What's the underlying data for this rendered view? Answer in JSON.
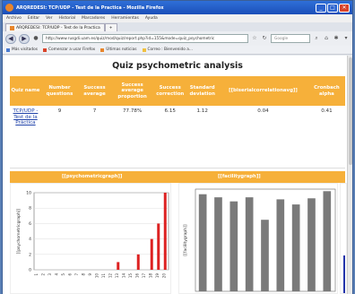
{
  "window": {
    "title": "ARQREDESI: TCP/UDP - Test de la Practica - Mozilla Firefox",
    "min_label": "_",
    "max_label": "□",
    "close_label": "✕"
  },
  "menu": [
    "Archivo",
    "Editar",
    "Ver",
    "Historial",
    "Marcadores",
    "Herramientas",
    "Ayuda"
  ],
  "tab": {
    "label": "ARQREDESI: TCP/UDP - Test de la Practica",
    "add_label": "+"
  },
  "nav": {
    "back": "◀",
    "forward": "▶",
    "url": "http://www.rusgdi.uam.es/quiz/mod/quiz/report.php?id=155&mode=quiz_psychometric",
    "search_placeholder": "Google"
  },
  "bookmarks": [
    {
      "label": "Más visitados",
      "color": "#4a7bd0"
    },
    {
      "label": "Comenzar a usar Firefox",
      "color": "#d9432a"
    },
    {
      "label": "Últimas noticias",
      "color": "#e8852b"
    },
    {
      "label": "Correo : Bienvenido a...",
      "color": "#f0c040"
    }
  ],
  "page": {
    "heading": "Quiz psychometric analysis",
    "table": {
      "headers": [
        "Quiz name",
        "Number questions",
        "Success average",
        "Success average proportion",
        "Success correction",
        "Standard deviation",
        "[[biserialcorrelationavg]]",
        "Cronbach alpha"
      ],
      "row": {
        "name": "TCP/UDP - Test de la Práctica",
        "questions": "9",
        "success_avg": "7",
        "success_prop": "77.78%",
        "correction": "6.15",
        "std_dev": "1.12",
        "biserial": "0.04",
        "cronbach": "0.41"
      }
    },
    "charts": {
      "left_title": "[[psychometricgraph]]",
      "right_title": "[[facilitygraph]]",
      "left_ylabel": "[[psychometricgraph]]",
      "right_ylabel": "[[facilitygraph]]"
    }
  },
  "chart_data": [
    {
      "type": "bar",
      "title": "[[psychometricgraph]]",
      "ylabel": "[[psychometricgraph]]",
      "yticks": [
        "0",
        "2",
        "4",
        "6",
        "8",
        "10"
      ],
      "ylim": [
        0,
        10
      ],
      "categories": [
        "1",
        "2",
        "3",
        "4",
        "5",
        "6",
        "7",
        "8",
        "9",
        "10",
        "11",
        "12",
        "13",
        "14",
        "15",
        "16",
        "17",
        "18",
        "19",
        "20"
      ],
      "values": [
        0,
        0,
        0,
        0,
        0,
        0,
        0,
        0,
        0,
        0,
        0,
        0,
        1,
        0,
        0,
        2,
        0,
        4,
        6,
        10
      ],
      "color": "#dd2222",
      "grid": true
    },
    {
      "type": "bar",
      "title": "[[facilitygraph]]",
      "ylabel": "[[facilitygraph]]",
      "ylim": [
        0,
        100
      ],
      "categories": [
        "1",
        "2",
        "3",
        "4",
        "5",
        "6",
        "7",
        "8",
        "9"
      ],
      "values": [
        95,
        92,
        88,
        92,
        70,
        90,
        85,
        91,
        98
      ],
      "color": "#7a7a7a",
      "grid": false
    }
  ]
}
